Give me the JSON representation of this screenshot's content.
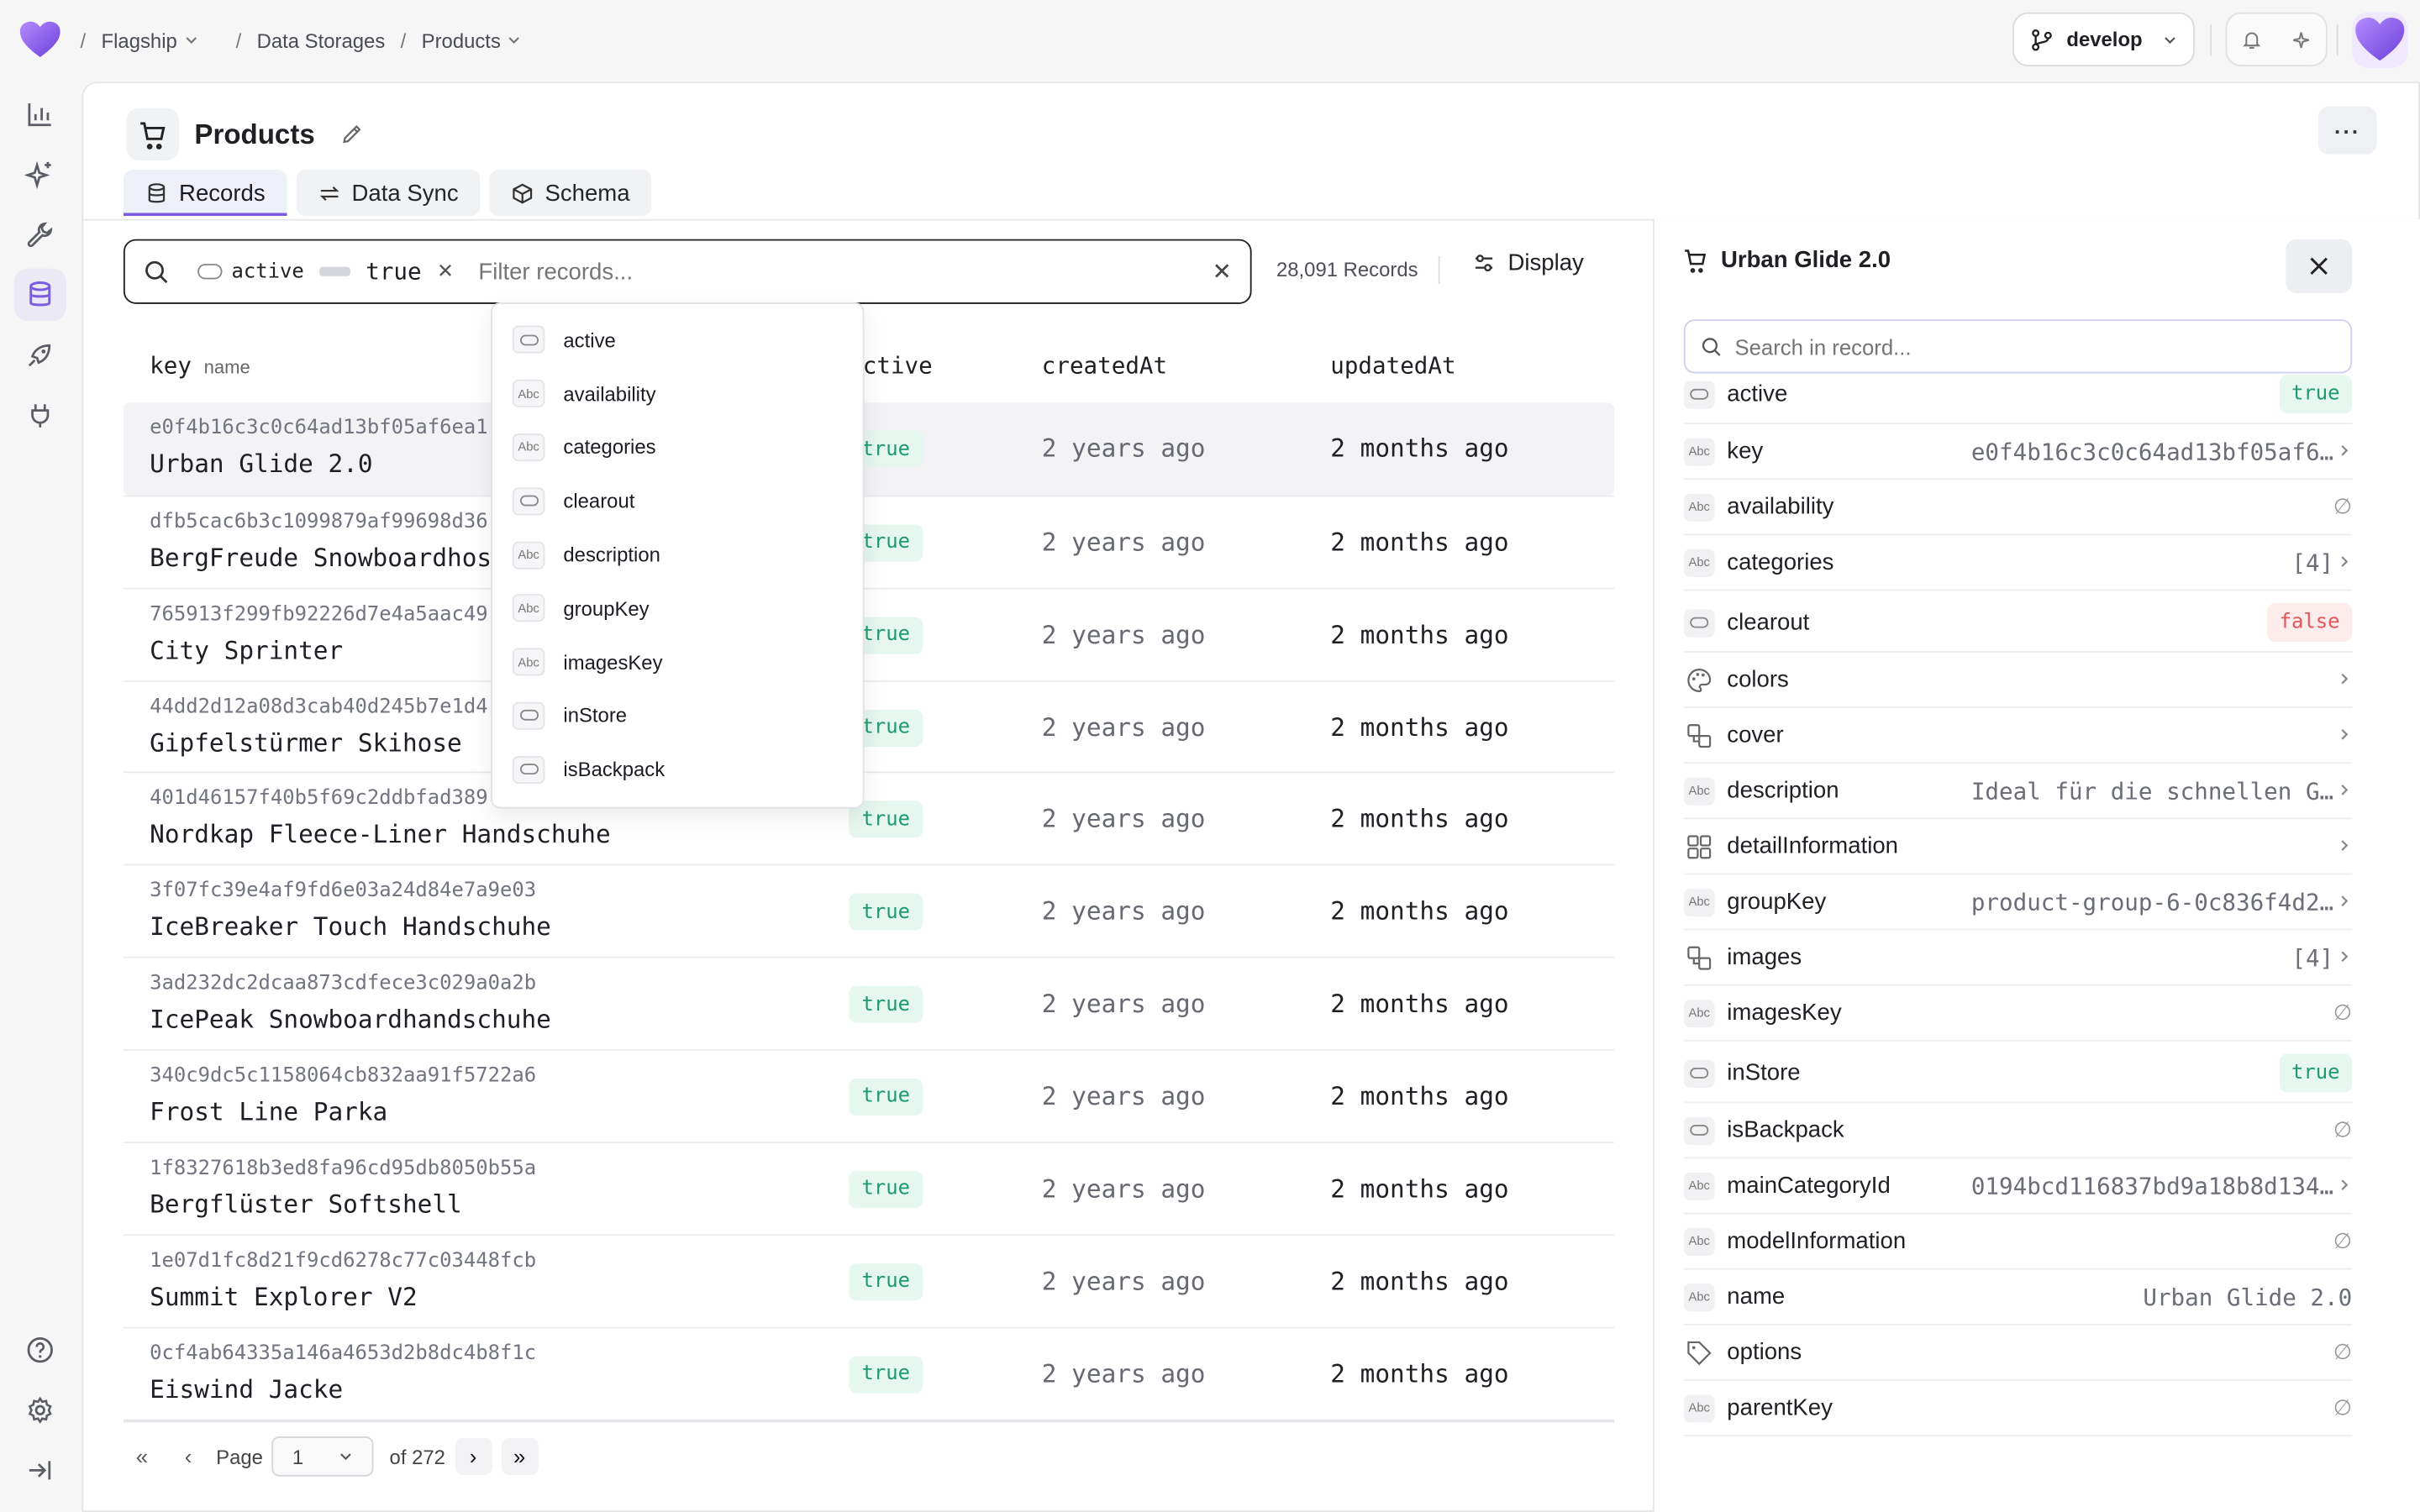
{
  "breadcrumb": {
    "sep": "/",
    "items": [
      "Flagship",
      "Data Storages",
      "Products"
    ]
  },
  "branch": {
    "name": "develop"
  },
  "page": {
    "title": "Products",
    "more": "···"
  },
  "tabs": [
    {
      "label": "Records",
      "icon": "database-icon",
      "active": true
    },
    {
      "label": "Data Sync",
      "icon": "sync-icon",
      "active": false
    },
    {
      "label": "Schema",
      "icon": "cube-icon",
      "active": false
    }
  ],
  "filter": {
    "chip_key": "active",
    "chip_value": "true",
    "placeholder": "Filter records...",
    "count": "28,091 Records",
    "display_label": "Display"
  },
  "table": {
    "headers": {
      "key": "key",
      "key_sub": "name",
      "active": "active",
      "created": "createdAt",
      "updated": "updatedAt"
    },
    "rows": [
      {
        "key": "e0f4b16c3c0c64ad13bf05af6ea1",
        "name": "Urban Glide 2.0",
        "active": "true",
        "created": "2 years ago",
        "updated": "2 months ago"
      },
      {
        "key": "dfb5cac6b3c1099879af99698d36",
        "name": "BergFreude Snowboardhose",
        "active": "true",
        "created": "2 years ago",
        "updated": "2 months ago"
      },
      {
        "key": "765913f299fb92226d7e4a5aac49",
        "name": "City Sprinter",
        "active": "true",
        "created": "2 years ago",
        "updated": "2 months ago"
      },
      {
        "key": "44dd2d12a08d3cab40d245b7e1d4",
        "name": "Gipfelstürmer Skihose",
        "active": "true",
        "created": "2 years ago",
        "updated": "2 months ago"
      },
      {
        "key": "401d46157f40b5f69c2ddbfad389",
        "name": "Nordkap Fleece-Liner Handschuhe",
        "active": "true",
        "created": "2 years ago",
        "updated": "2 months ago"
      },
      {
        "key": "3f07fc39e4af9fd6e03a24d84e7a9e03",
        "name": "IceBreaker Touch Handschuhe",
        "active": "true",
        "created": "2 years ago",
        "updated": "2 months ago"
      },
      {
        "key": "3ad232dc2dcaa873cdfece3c029a0a2b",
        "name": "IcePeak Snowboardhandschuhe",
        "active": "true",
        "created": "2 years ago",
        "updated": "2 months ago"
      },
      {
        "key": "340c9dc5c1158064cb832aa91f5722a6",
        "name": "Frost Line Parka",
        "active": "true",
        "created": "2 years ago",
        "updated": "2 months ago"
      },
      {
        "key": "1f8327618b3ed8fa96cd95db8050b55a",
        "name": "Bergflüster Softshell",
        "active": "true",
        "created": "2 years ago",
        "updated": "2 months ago"
      },
      {
        "key": "1e07d1fc8d21f9cd6278c77c03448fcb",
        "name": "Summit Explorer V2",
        "active": "true",
        "created": "2 years ago",
        "updated": "2 months ago"
      },
      {
        "key": "0cf4ab64335a146a4653d2b8dc4b8f1c",
        "name": "Eiswind Jacke",
        "active": "true",
        "created": "2 years ago",
        "updated": "2 months ago"
      }
    ]
  },
  "pager": {
    "page_label": "Page",
    "page_value": "1",
    "of_label": "of 272"
  },
  "dropdown": {
    "items": [
      {
        "label": "active",
        "type": "bool"
      },
      {
        "label": "availability",
        "type": "Abc"
      },
      {
        "label": "categories",
        "type": "Abc"
      },
      {
        "label": "clearout",
        "type": "bool"
      },
      {
        "label": "description",
        "type": "Abc"
      },
      {
        "label": "groupKey",
        "type": "Abc"
      },
      {
        "label": "imagesKey",
        "type": "Abc"
      },
      {
        "label": "inStore",
        "type": "bool"
      },
      {
        "label": "isBackpack",
        "type": "bool"
      }
    ]
  },
  "record": {
    "title": "Urban Glide 2.0",
    "search_placeholder": "Search in record...",
    "fields": [
      {
        "label": "active",
        "type": "bool",
        "value": "true",
        "kind": "true"
      },
      {
        "label": "key",
        "type": "Abc",
        "value": "e0f4b16c3c0c64ad13bf05af6…",
        "kind": "text",
        "chevron": true
      },
      {
        "label": "availability",
        "type": "Abc",
        "value": "∅",
        "kind": "null"
      },
      {
        "label": "categories",
        "type": "Abc",
        "value": "[4]",
        "kind": "text",
        "chevron": true
      },
      {
        "label": "clearout",
        "type": "bool",
        "value": "false",
        "kind": "false"
      },
      {
        "label": "colors",
        "type": "palette",
        "value": "",
        "kind": "none",
        "chevron": true
      },
      {
        "label": "cover",
        "type": "ref",
        "value": "",
        "kind": "none",
        "chevron": true
      },
      {
        "label": "description",
        "type": "Abc",
        "value": "Ideal für die schnellen G…",
        "kind": "text",
        "chevron": true
      },
      {
        "label": "detailInformation",
        "type": "grid",
        "value": "",
        "kind": "none",
        "chevron": true
      },
      {
        "label": "groupKey",
        "type": "Abc",
        "value": "product-group-6-0c836f4d2…",
        "kind": "text",
        "chevron": true
      },
      {
        "label": "images",
        "type": "ref",
        "value": "[4]",
        "kind": "text",
        "chevron": true
      },
      {
        "label": "imagesKey",
        "type": "Abc",
        "value": "∅",
        "kind": "null"
      },
      {
        "label": "inStore",
        "type": "bool",
        "value": "true",
        "kind": "true"
      },
      {
        "label": "isBackpack",
        "type": "bool",
        "value": "∅",
        "kind": "null"
      },
      {
        "label": "mainCategoryId",
        "type": "Abc",
        "value": "0194bcd116837bd9a18b8d134…",
        "kind": "text",
        "chevron": true
      },
      {
        "label": "modelInformation",
        "type": "Abc",
        "value": "∅",
        "kind": "null"
      },
      {
        "label": "name",
        "type": "Abc",
        "value": "Urban Glide 2.0",
        "kind": "textnochev"
      },
      {
        "label": "options",
        "type": "tag",
        "value": "∅",
        "kind": "null"
      },
      {
        "label": "parentKey",
        "type": "Abc",
        "value": "∅",
        "kind": "null"
      }
    ]
  },
  "colors": {
    "accent": "#7b5be0",
    "true_bg": "#e6f7ef",
    "true_fg": "#1f9b6a",
    "false_bg": "#fdecec",
    "false_fg": "#e0575c"
  }
}
